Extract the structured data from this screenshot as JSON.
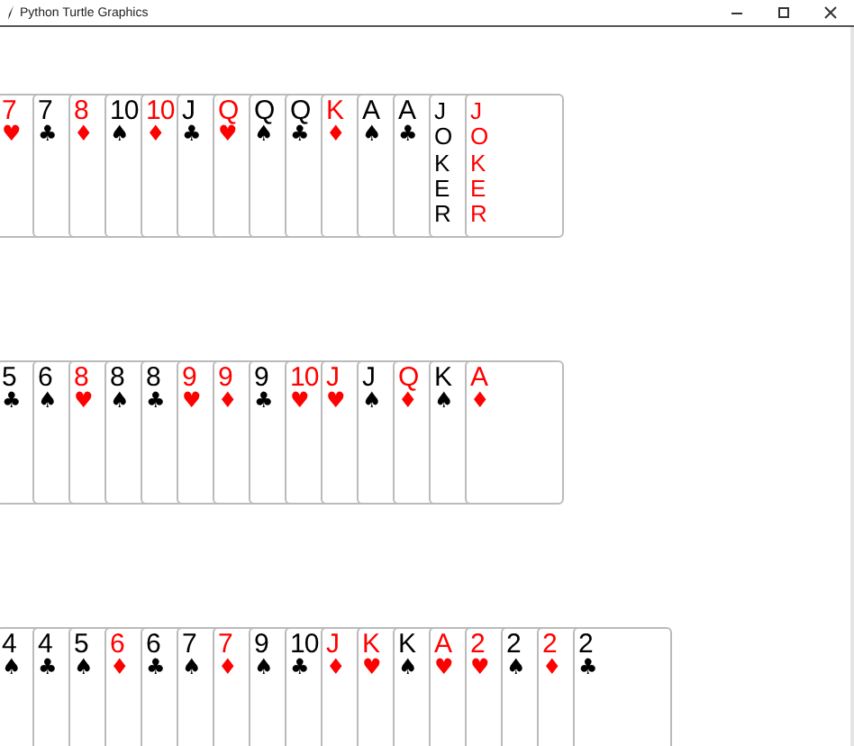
{
  "window": {
    "title": "Python Turtle Graphics"
  },
  "rows": [
    {
      "cards": [
        {
          "kind": "normal",
          "rank": "7",
          "suit": "♥",
          "color": "#ff0000"
        },
        {
          "kind": "normal",
          "rank": "7",
          "suit": "♣",
          "color": "#000000"
        },
        {
          "kind": "normal",
          "rank": "8",
          "suit": "♦",
          "color": "#ff0000"
        },
        {
          "kind": "normal",
          "rank": "10",
          "suit": "♠",
          "color": "#000000"
        },
        {
          "kind": "normal",
          "rank": "10",
          "suit": "♦",
          "color": "#ff0000"
        },
        {
          "kind": "normal",
          "rank": "J",
          "suit": "♣",
          "color": "#000000"
        },
        {
          "kind": "normal",
          "rank": "Q",
          "suit": "♥",
          "color": "#ff0000"
        },
        {
          "kind": "normal",
          "rank": "Q",
          "suit": "♠",
          "color": "#000000"
        },
        {
          "kind": "normal",
          "rank": "Q",
          "suit": "♣",
          "color": "#000000"
        },
        {
          "kind": "normal",
          "rank": "K",
          "suit": "♦",
          "color": "#ff0000"
        },
        {
          "kind": "normal",
          "rank": "A",
          "suit": "♠",
          "color": "#000000"
        },
        {
          "kind": "normal",
          "rank": "A",
          "suit": "♣",
          "color": "#000000"
        },
        {
          "kind": "joker",
          "rank": "JOKER",
          "color": "#000000"
        },
        {
          "kind": "joker",
          "rank": "JOKER",
          "color": "#ff0000"
        }
      ]
    },
    {
      "cards": [
        {
          "kind": "normal",
          "rank": "5",
          "suit": "♣",
          "color": "#000000"
        },
        {
          "kind": "normal",
          "rank": "6",
          "suit": "♠",
          "color": "#000000"
        },
        {
          "kind": "normal",
          "rank": "8",
          "suit": "♥",
          "color": "#ff0000"
        },
        {
          "kind": "normal",
          "rank": "8",
          "suit": "♠",
          "color": "#000000"
        },
        {
          "kind": "normal",
          "rank": "8",
          "suit": "♣",
          "color": "#000000"
        },
        {
          "kind": "normal",
          "rank": "9",
          "suit": "♥",
          "color": "#ff0000"
        },
        {
          "kind": "normal",
          "rank": "9",
          "suit": "♦",
          "color": "#ff0000"
        },
        {
          "kind": "normal",
          "rank": "9",
          "suit": "♣",
          "color": "#000000"
        },
        {
          "kind": "normal",
          "rank": "10",
          "suit": "♥",
          "color": "#ff0000"
        },
        {
          "kind": "normal",
          "rank": "J",
          "suit": "♥",
          "color": "#ff0000"
        },
        {
          "kind": "normal",
          "rank": "J",
          "suit": "♠",
          "color": "#000000"
        },
        {
          "kind": "normal",
          "rank": "Q",
          "suit": "♦",
          "color": "#ff0000"
        },
        {
          "kind": "normal",
          "rank": "K",
          "suit": "♠",
          "color": "#000000"
        },
        {
          "kind": "normal",
          "rank": "A",
          "suit": "♦",
          "color": "#ff0000"
        }
      ]
    },
    {
      "cards": [
        {
          "kind": "normal",
          "rank": "4",
          "suit": "♠",
          "color": "#000000"
        },
        {
          "kind": "normal",
          "rank": "4",
          "suit": "♣",
          "color": "#000000"
        },
        {
          "kind": "normal",
          "rank": "5",
          "suit": "♠",
          "color": "#000000"
        },
        {
          "kind": "normal",
          "rank": "6",
          "suit": "♦",
          "color": "#ff0000"
        },
        {
          "kind": "normal",
          "rank": "6",
          "suit": "♣",
          "color": "#000000"
        },
        {
          "kind": "normal",
          "rank": "7",
          "suit": "♠",
          "color": "#000000"
        },
        {
          "kind": "normal",
          "rank": "7",
          "suit": "♦",
          "color": "#ff0000"
        },
        {
          "kind": "normal",
          "rank": "9",
          "suit": "♠",
          "color": "#000000"
        },
        {
          "kind": "normal",
          "rank": "10",
          "suit": "♣",
          "color": "#000000"
        },
        {
          "kind": "normal",
          "rank": "J",
          "suit": "♦",
          "color": "#ff0000"
        },
        {
          "kind": "normal",
          "rank": "K",
          "suit": "♥",
          "color": "#ff0000"
        },
        {
          "kind": "normal",
          "rank": "K",
          "suit": "♠",
          "color": "#000000"
        },
        {
          "kind": "normal",
          "rank": "A",
          "suit": "♥",
          "color": "#ff0000"
        },
        {
          "kind": "normal",
          "rank": "2",
          "suit": "♥",
          "color": "#ff0000"
        },
        {
          "kind": "normal",
          "rank": "2",
          "suit": "♠",
          "color": "#000000"
        },
        {
          "kind": "normal",
          "rank": "2",
          "suit": "♦",
          "color": "#ff0000"
        },
        {
          "kind": "normal",
          "rank": "2",
          "suit": "♣",
          "color": "#000000"
        }
      ]
    }
  ]
}
